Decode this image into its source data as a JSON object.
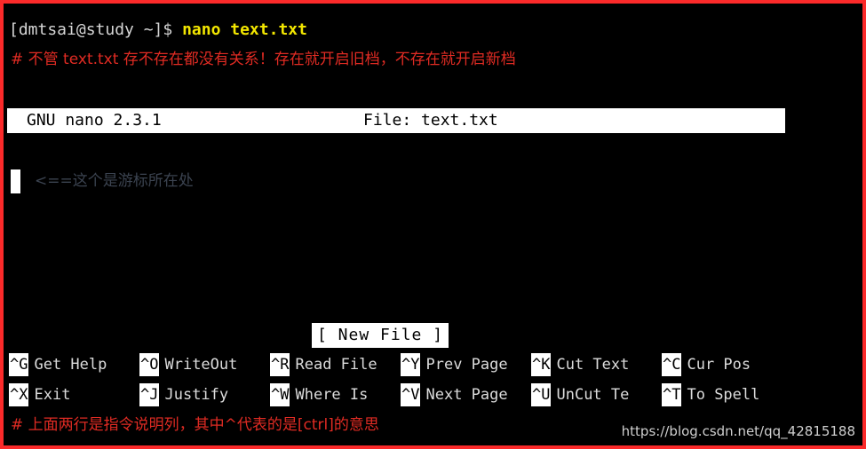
{
  "window": {
    "border_color": "#fb2a2a",
    "background_color": "#000000"
  },
  "shell": {
    "prompt": "[dmtsai@study ~]$ ",
    "command": "nano text.txt",
    "prompt_color": "#d6d6d6",
    "command_color": "#f2e600"
  },
  "annotations": {
    "top_comment": "# 不管 text.txt 存不存在都没有关系！存在就开启旧档，不存在就开启新档",
    "bottom_comment": "# 上面两行是指令说明列，其中^代表的是[ctrl]的意思",
    "cursor_note": "<==这个是游标所在处",
    "comment_color": "#e02b23",
    "cursor_note_color": "#3b4350"
  },
  "nano": {
    "titlebar": {
      "version": "GNU nano 2.3.1",
      "file_label": "File: text.txt",
      "background": "#ffffff",
      "foreground": "#000000"
    },
    "status": {
      "new_file": "[ New File ]"
    },
    "shortcuts_row1": [
      {
        "key": "^G",
        "label": "Get Help"
      },
      {
        "key": "^O",
        "label": "WriteOut"
      },
      {
        "key": "^R",
        "label": "Read File"
      },
      {
        "key": "^Y",
        "label": "Prev Page"
      },
      {
        "key": "^K",
        "label": "Cut Text"
      },
      {
        "key": "^C",
        "label": "Cur Pos"
      }
    ],
    "shortcuts_row2": [
      {
        "key": "^X",
        "label": "Exit"
      },
      {
        "key": "^J",
        "label": "Justify"
      },
      {
        "key": "^W",
        "label": "Where Is"
      },
      {
        "key": "^V",
        "label": "Next Page"
      },
      {
        "key": "^U",
        "label": "UnCut Te"
      },
      {
        "key": "^T",
        "label": "To Spell"
      }
    ]
  },
  "watermark": {
    "text": "https://blog.csdn.net/qq_42815188"
  }
}
